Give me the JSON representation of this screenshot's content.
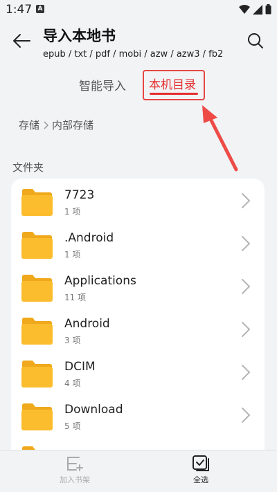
{
  "status_bar": {
    "time": "1:47",
    "notification_letter": "A"
  },
  "header": {
    "title": "导入本地书",
    "subtitle": "epub / txt / pdf / mobi / azw / azw3 / fb2"
  },
  "tabs": {
    "smart_import": "智能导入",
    "local_directory": "本机目录",
    "active": "local_directory"
  },
  "breadcrumb": {
    "root": "存储",
    "current": "内部存储"
  },
  "section_label": "文件夹",
  "folders": [
    {
      "name": "7723",
      "count": "1 项"
    },
    {
      "name": ".Android",
      "count": "1 项"
    },
    {
      "name": "Applications",
      "count": "11 项"
    },
    {
      "name": "Android",
      "count": "3 项"
    },
    {
      "name": "DCIM",
      "count": "4 项"
    },
    {
      "name": "Download",
      "count": "5 项"
    }
  ],
  "bottom_bar": {
    "add_to_shelf": "加入书架",
    "select_all": "全选"
  },
  "colors": {
    "accent": "#e52e2e",
    "folder": "#fbbd2e",
    "background": "#f1f3f5"
  }
}
